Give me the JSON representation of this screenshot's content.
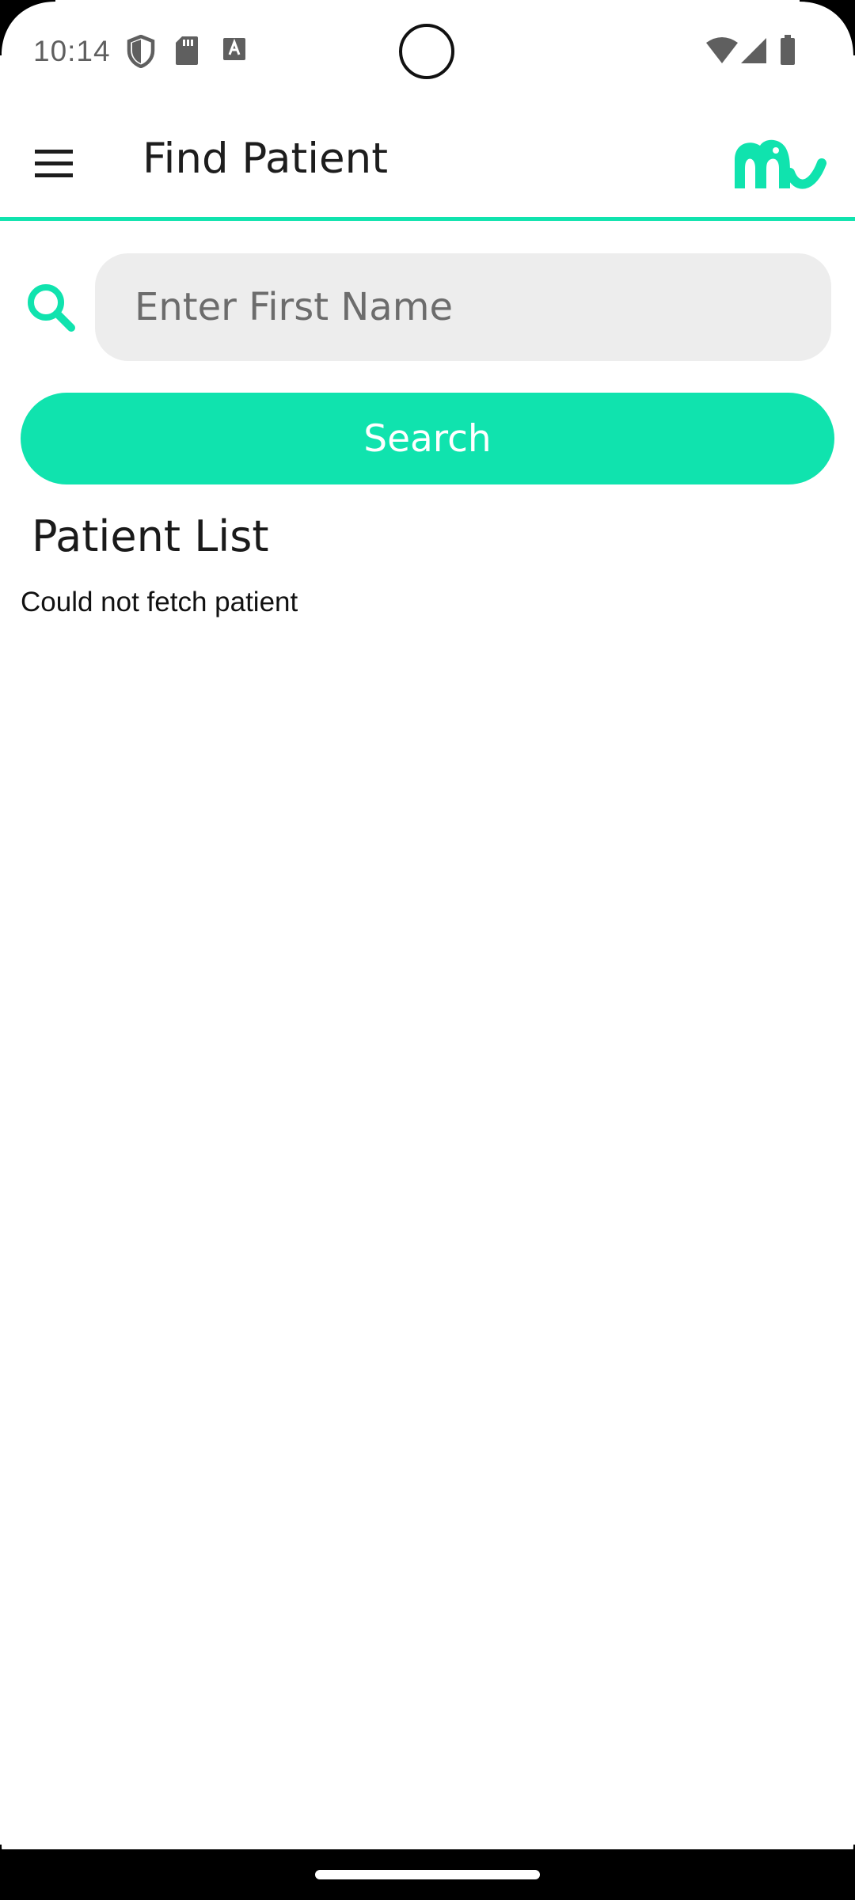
{
  "status_bar": {
    "time": "10:14",
    "left_icons": [
      "shield-icon",
      "sd-card-icon",
      "text-a-icon"
    ],
    "right_icons": [
      "wifi-icon",
      "signal-icon",
      "battery-icon"
    ]
  },
  "app_bar": {
    "title": "Find Patient",
    "menu_icon": "hamburger-menu-icon",
    "logo_icon": "elephant-logo-icon"
  },
  "search": {
    "icon": "search-icon",
    "placeholder": "Enter First Name",
    "value": "",
    "button_label": "Search"
  },
  "patient_list": {
    "title": "Patient List",
    "message": "Could not fetch patient"
  },
  "colors": {
    "accent": "#10e3ae",
    "field_bg": "#ededed",
    "text_dark": "#1a1a1a"
  }
}
